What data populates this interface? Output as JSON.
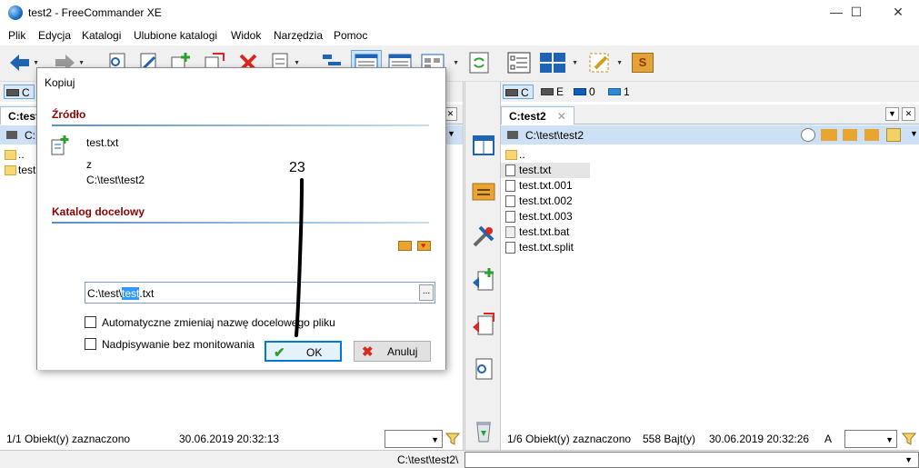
{
  "window": {
    "title": "test2 - FreeCommander XE",
    "minimize_glyph": "—",
    "maximize_glyph": "☐",
    "close_glyph": "✕"
  },
  "menu": [
    "Plik",
    "Edycja",
    "Katalogi",
    "Ulubione katalogi",
    "Widok",
    "Narzędzia",
    "Pomoc"
  ],
  "toolbar": {
    "icons": [
      "back-arrow-icon",
      "forward-arrow-icon",
      "view-file-icon",
      "edit-file-icon",
      "copy-icon",
      "move-icon",
      "delete-icon",
      "pack-icon",
      "tree-icon",
      "brief-view-icon",
      "detail-view-icon",
      "thumbnail-view-icon",
      "sync-icon",
      "checklist-icon",
      "layout-icon",
      "settings-icon",
      "sort-icon"
    ],
    "sort_label": "S"
  },
  "left_panel": {
    "drive": "C",
    "tab": "C:test",
    "path": "C:",
    "files": [
      "..",
      "test"
    ]
  },
  "right_panel": {
    "drives": [
      {
        "label": "C",
        "icon": "drive-icon"
      },
      {
        "label": "E",
        "icon": "drive-icon"
      },
      {
        "label": "0",
        "icon": "monitor-icon"
      },
      {
        "label": "1",
        "icon": "network-icon"
      }
    ],
    "tab": "C:test2",
    "tab_close": "✕",
    "path": "C:\\test\\test2",
    "files": [
      {
        "name": "..",
        "type": "folder"
      },
      {
        "name": "test.txt",
        "type": "file",
        "selected": true
      },
      {
        "name": "test.txt.001",
        "type": "file"
      },
      {
        "name": "test.txt.002",
        "type": "file"
      },
      {
        "name": "test.txt.003",
        "type": "file"
      },
      {
        "name": "test.txt.bat",
        "type": "bat"
      },
      {
        "name": "test.txt.split",
        "type": "file"
      }
    ]
  },
  "status": {
    "left_selected": "1/1 Obiekt(y) zaznaczono",
    "left_datetime": "30.06.2019 20:32:13",
    "right_selected": "1/6 Obiekt(y) zaznaczono",
    "right_size": "558 Bajt(y)",
    "right_datetime": "30.06.2019 20:32:26",
    "right_attr": "A"
  },
  "bottom": {
    "current_path": "C:\\test\\test2\\"
  },
  "dialog": {
    "title": "Kopiuj",
    "source_heading": "Źródło",
    "source_file": "test.txt",
    "from_label": "z",
    "source_dir": "C:\\test\\test2",
    "target_heading": "Katalog docelowy",
    "target_prefix": "C:\\test\\",
    "target_selected": "test",
    "target_suffix": ".txt",
    "browse_label": "...",
    "option_rename": "Automatyczne zmieniaj nazwę docelowego pliku",
    "option_overwrite": "Nadpisywanie bez monitowania",
    "ok_label": "OK",
    "cancel_label": "Anuluj"
  },
  "annotation": {
    "number": "23"
  },
  "colors": {
    "accent": "#0078d7",
    "section_heading": "#8b0000",
    "path_bar": "#cde0f5",
    "selection": "#3399ff",
    "delete_red": "#d9281e"
  }
}
